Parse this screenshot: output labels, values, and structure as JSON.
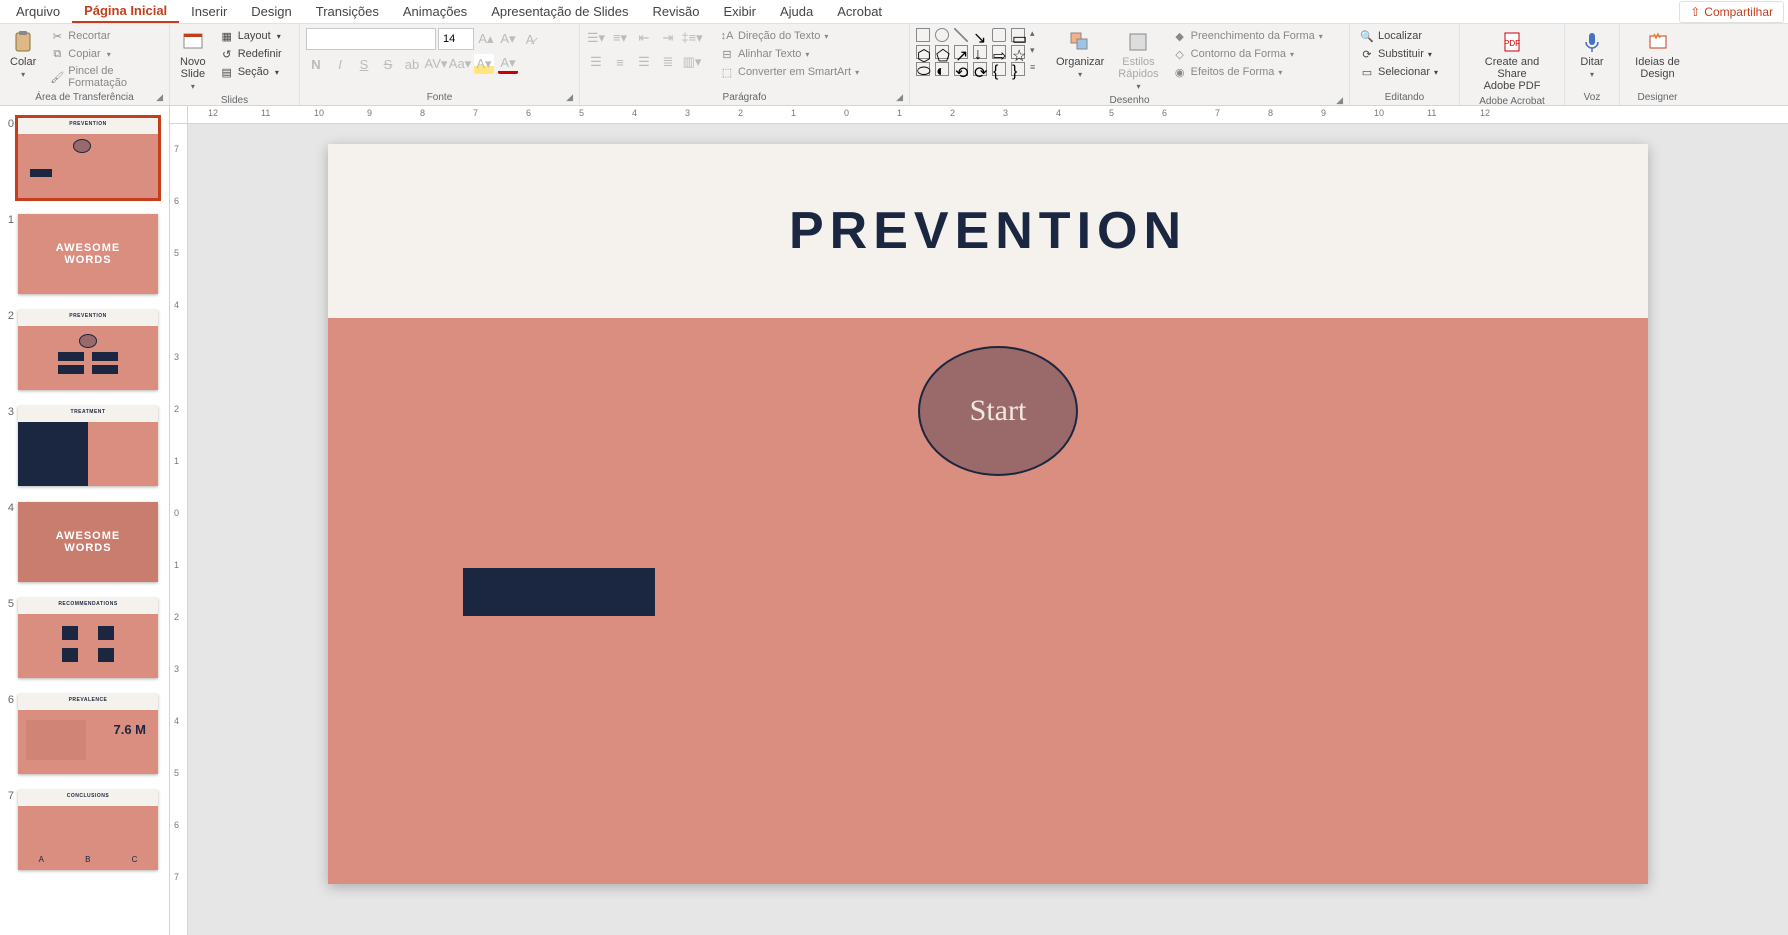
{
  "menu": {
    "file": "Arquivo",
    "home": "Página Inicial",
    "insert": "Inserir",
    "design": "Design",
    "transitions": "Transições",
    "animations": "Animações",
    "slideshow": "Apresentação de Slides",
    "review": "Revisão",
    "view": "Exibir",
    "help": "Ajuda",
    "acrobat": "Acrobat",
    "share": "Compartilhar"
  },
  "ribbon": {
    "clipboard": {
      "paste": "Colar",
      "cut": "Recortar",
      "copy": "Copiar",
      "format_painter": "Pincel de Formatação",
      "label": "Área de Transferência"
    },
    "slides": {
      "new_slide": "Novo\nSlide",
      "layout": "Layout",
      "reset": "Redefinir",
      "section": "Seção",
      "label": "Slides"
    },
    "font": {
      "name": "",
      "size": "14",
      "label": "Fonte"
    },
    "paragraph": {
      "text_direction": "Direção do Texto",
      "align_text": "Alinhar Texto",
      "convert_smartart": "Converter em SmartArt",
      "label": "Parágrafo"
    },
    "drawing": {
      "arrange": "Organizar",
      "quick_styles": "Estilos\nRápidos",
      "shape_fill": "Preenchimento da Forma",
      "shape_outline": "Contorno da Forma",
      "shape_effects": "Efeitos de Forma",
      "label": "Desenho"
    },
    "editing": {
      "find": "Localizar",
      "replace": "Substituir",
      "select": "Selecionar",
      "label": "Editando"
    },
    "acrobat": {
      "create_share": "Create and Share\nAdobe PDF",
      "label": "Adobe Acrobat"
    },
    "voice": {
      "dictate": "Ditar",
      "label": "Voz"
    },
    "designer": {
      "ideas": "Ideias de\nDesign",
      "label": "Designer"
    }
  },
  "slide": {
    "title": "PREVENTION",
    "start": "Start"
  },
  "thumbs": [
    {
      "num": "0",
      "title": "PREVENTION"
    },
    {
      "num": "1",
      "title": "AWESOME WORDS"
    },
    {
      "num": "2",
      "title": "PREVENTION"
    },
    {
      "num": "3",
      "title": "TREATMENT"
    },
    {
      "num": "4",
      "title": "AWESOME WORDS"
    },
    {
      "num": "5",
      "title": "RECOMMENDATIONS"
    },
    {
      "num": "6",
      "title": "PREVALENCE",
      "stat": "7.6 M"
    },
    {
      "num": "7",
      "title": "CONCLUSIONS"
    }
  ],
  "ruler_h": [
    "12",
    "11",
    "10",
    "9",
    "8",
    "7",
    "6",
    "5",
    "4",
    "3",
    "2",
    "1",
    "0",
    "1",
    "2",
    "3",
    "4",
    "5",
    "6",
    "7",
    "8",
    "9",
    "10",
    "11",
    "12"
  ],
  "ruler_v": [
    "7",
    "6",
    "5",
    "4",
    "3",
    "2",
    "1",
    "0",
    "1",
    "2",
    "3",
    "4",
    "5",
    "6",
    "7"
  ]
}
